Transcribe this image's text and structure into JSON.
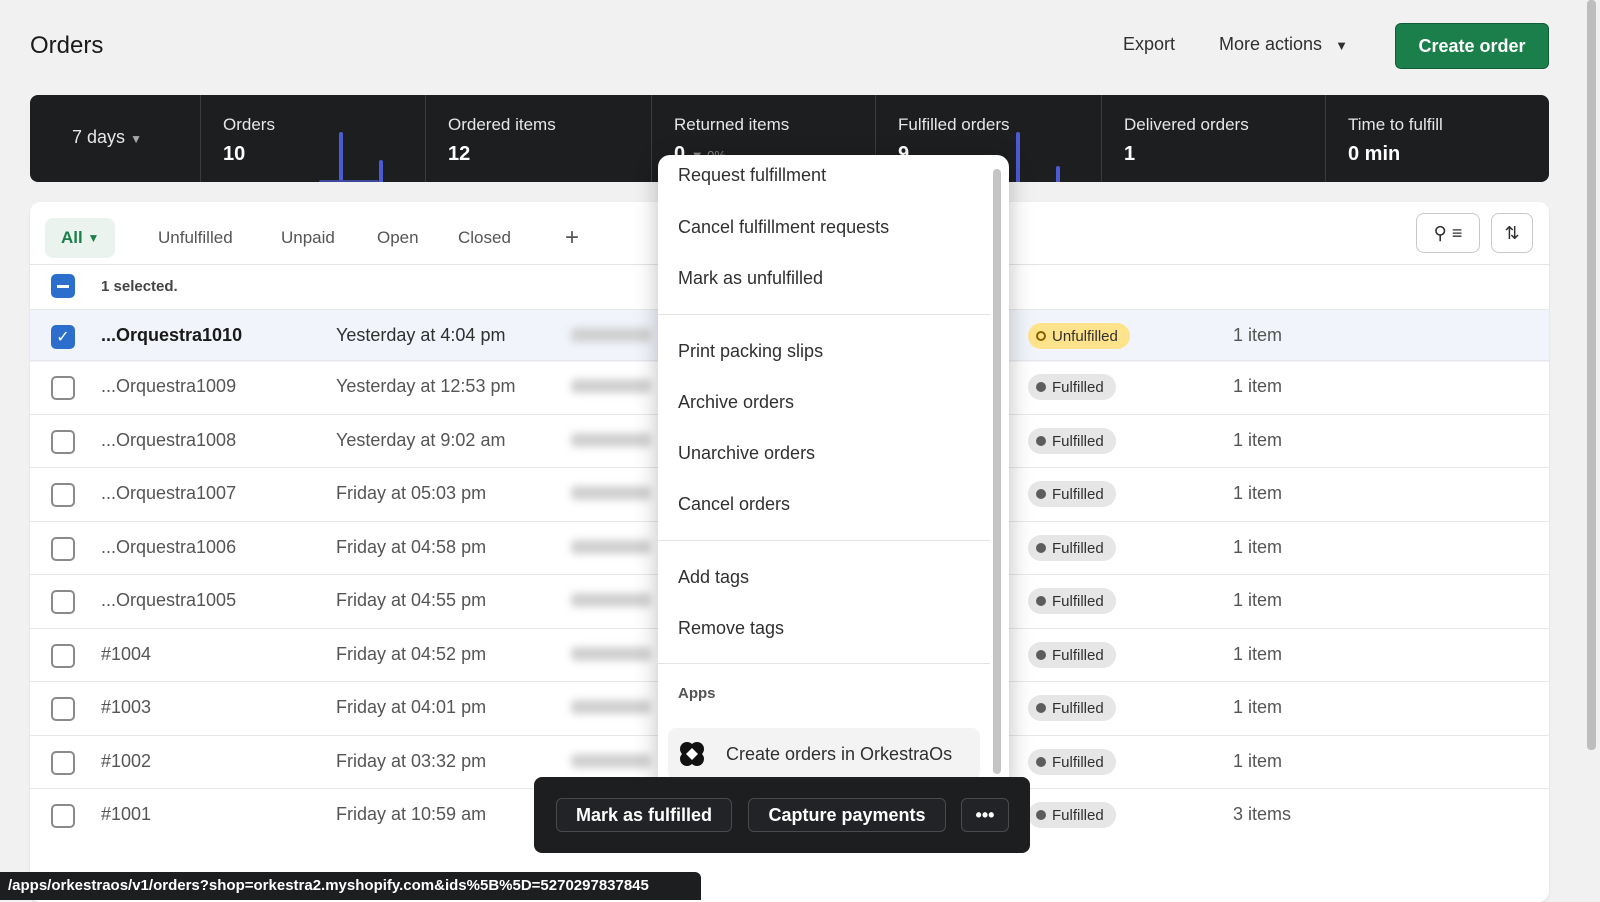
{
  "header": {
    "title": "Orders",
    "export": "Export",
    "more_actions": "More actions",
    "create_order": "Create order"
  },
  "stats": {
    "period": "7 days",
    "metrics": [
      {
        "label": "Orders",
        "value": "10"
      },
      {
        "label": "Ordered items",
        "value": "12"
      },
      {
        "label": "Returned items",
        "value": "0",
        "change": "0%"
      },
      {
        "label": "Fulfilled orders",
        "value": "9"
      },
      {
        "label": "Delivered orders",
        "value": "1"
      },
      {
        "label": "Time to fulfill",
        "value": "0 min"
      }
    ]
  },
  "tabs": [
    "All",
    "Unfulfilled",
    "Unpaid",
    "Open",
    "Closed"
  ],
  "selection": {
    "text": "1 selected."
  },
  "orders": [
    {
      "id": "...Orquestra1010",
      "date": "Yesterday at 4:04 pm",
      "status": "Unfulfilled",
      "items": "1 item",
      "selected": true
    },
    {
      "id": "...Orquestra1009",
      "date": "Yesterday at 12:53 pm",
      "status": "Fulfilled",
      "items": "1 item"
    },
    {
      "id": "...Orquestra1008",
      "date": "Yesterday at 9:02 am",
      "status": "Fulfilled",
      "items": "1 item"
    },
    {
      "id": "...Orquestra1007",
      "date": "Friday at 05:03 pm",
      "status": "Fulfilled",
      "items": "1 item"
    },
    {
      "id": "...Orquestra1006",
      "date": "Friday at 04:58 pm",
      "status": "Fulfilled",
      "items": "1 item"
    },
    {
      "id": "...Orquestra1005",
      "date": "Friday at 04:55 pm",
      "status": "Fulfilled",
      "items": "1 item"
    },
    {
      "id": "#1004",
      "date": "Friday at 04:52 pm",
      "status": "Fulfilled",
      "items": "1 item"
    },
    {
      "id": "#1003",
      "date": "Friday at 04:01 pm",
      "status": "Fulfilled",
      "items": "1 item"
    },
    {
      "id": "#1002",
      "date": "Friday at 03:32 pm",
      "status": "Fulfilled",
      "items": "1 item"
    },
    {
      "id": "#1001",
      "date": "Friday at 10:59 am",
      "status": "Fulfilled",
      "items": "3 items"
    }
  ],
  "menu": {
    "groups": [
      [
        "Request fulfillment",
        "Cancel fulfillment requests",
        "Mark as unfulfilled"
      ],
      [
        "Print packing slips",
        "Archive orders",
        "Unarchive orders",
        "Cancel orders"
      ],
      [
        "Add tags",
        "Remove tags"
      ]
    ],
    "apps_heading": "Apps",
    "app_item": "Create orders in OrkestraOs"
  },
  "bulk": {
    "mark_fulfilled": "Mark as fulfilled",
    "capture_payments": "Capture payments",
    "more": "•••"
  },
  "status_url": "/apps/orkestraos/v1/orders?shop=orkestra2.myshopify.com&ids%5B%5D=5270297837845",
  "colors": {
    "accent": "#1a7f4b",
    "selected": "#2c6ecb",
    "unfulfilled": "#ffe38a",
    "chart": "#4c5bd4"
  }
}
